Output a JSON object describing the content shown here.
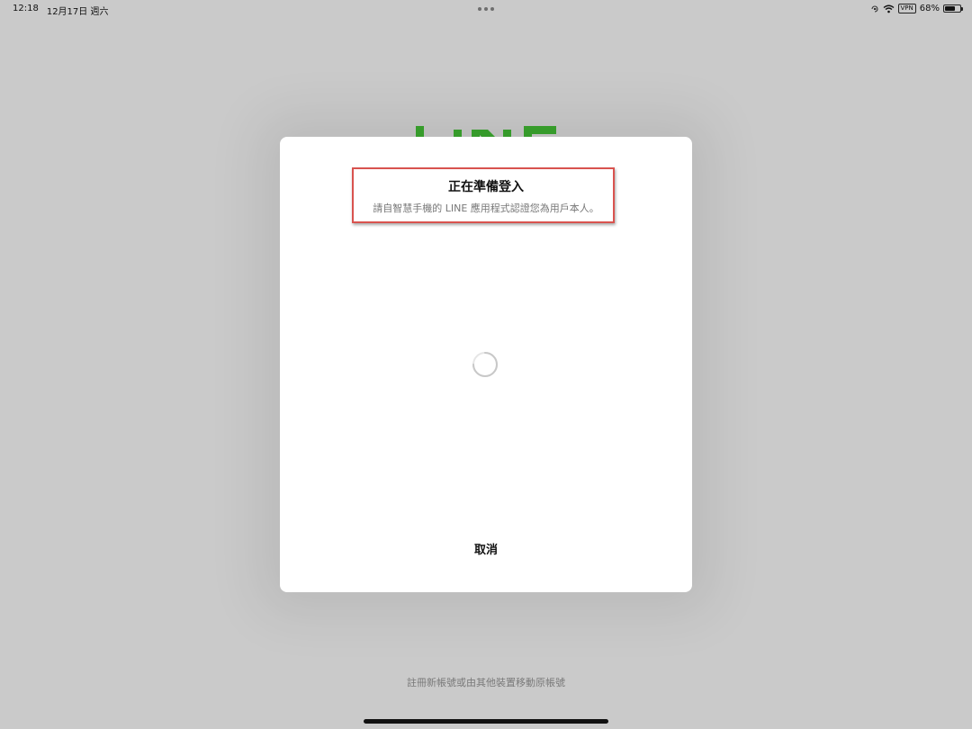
{
  "status_bar": {
    "time": "12:18",
    "date": "12月17日 週六",
    "vpn_label": "VPN",
    "battery_text": "68%",
    "battery_level": 0.68,
    "icons": [
      "multitask-dots-icon",
      "rotation-lock-icon",
      "wifi-icon",
      "vpn-icon",
      "battery-icon"
    ]
  },
  "background": {
    "logo_name": "line-logo",
    "logo_color": "#3aa52e",
    "bottom_link": "註冊新帳號或由其他裝置移動原帳號"
  },
  "dialog": {
    "title": "正在準備登入",
    "subtitle": "請自智慧手機的 LINE 應用程式認證您為用戶本人。",
    "cancel_label": "取消",
    "highlight_color": "#d9534f",
    "loading_icon": "spinner-icon"
  }
}
